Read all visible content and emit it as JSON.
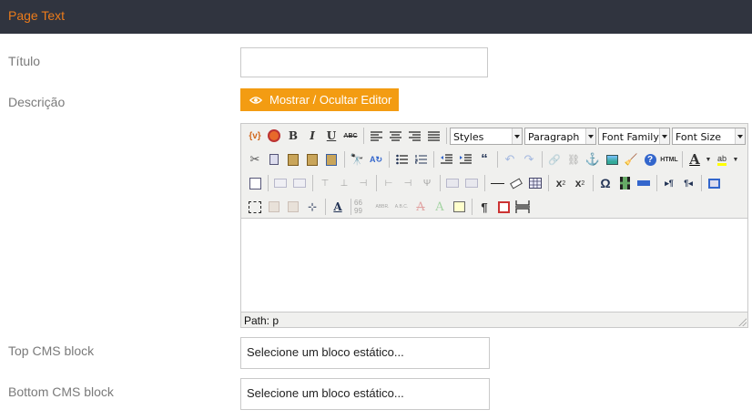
{
  "header": {
    "title": "Page Text"
  },
  "fields": {
    "titulo_label": "Título",
    "descricao_label": "Descrição",
    "toggle_editor_label": "Mostrar / Ocultar Editor",
    "top_cms_label": "Top CMS block",
    "top_cms_value": "Selecione um bloco estático...",
    "bottom_cms_label": "Bottom CMS block",
    "bottom_cms_value": "Selecione um bloco estático..."
  },
  "editor": {
    "styles": "Styles",
    "format": "Paragraph",
    "font_family": "Font Family",
    "font_size": "Font Size",
    "bold": "B",
    "italic": "I",
    "underline": "U",
    "strikethrough": "ABC",
    "subscript": "x",
    "superscript": "x",
    "omega": "Ω",
    "html": "HTML",
    "font_color": "A",
    "pilcrow": "¶",
    "status_path": "Path: p"
  }
}
